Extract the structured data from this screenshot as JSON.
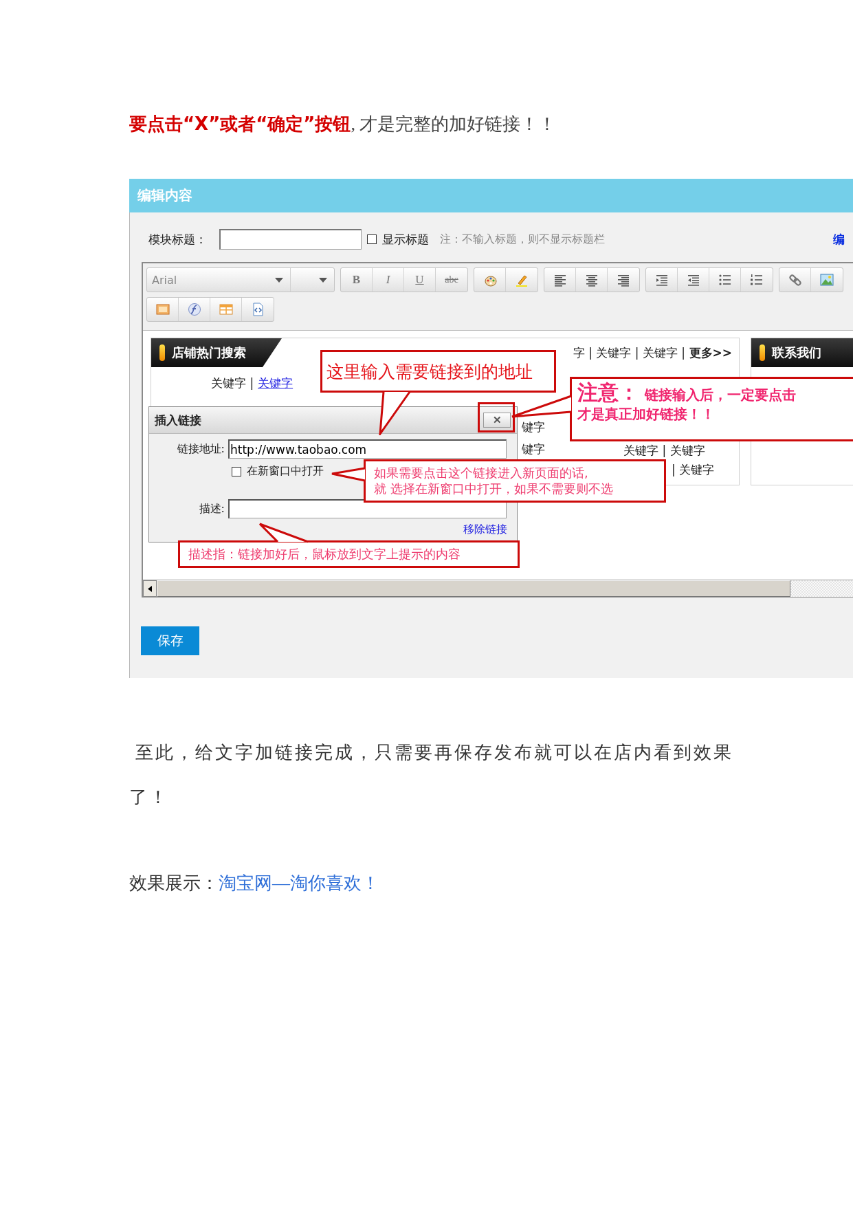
{
  "heading": "**要点击“X”或者“确定”按钮**, 才是完整的加好链接！！",
  "editor": {
    "title": "编辑内容",
    "module_title": {
      "label": "模块标题："
    },
    "show_title": {
      "label": "显示标题",
      "checked": false
    },
    "note": "注：不输入标题，则不显示标题栏",
    "edit_link": "编",
    "toolbar": [
      [
        [
          {
            "kind": "font-select",
            "value": "Arial"
          },
          {
            "kind": "size-select"
          }
        ],
        [
          {
            "kind": "bold",
            "label": "B"
          },
          {
            "kind": "italic",
            "label": "I"
          },
          {
            "kind": "underline",
            "label": "U"
          },
          {
            "kind": "strike",
            "label": "abc"
          }
        ],
        [
          {
            "kind": "text-color"
          },
          {
            "kind": "highlight"
          }
        ],
        [
          {
            "kind": "align-left"
          },
          {
            "kind": "align-center"
          },
          {
            "kind": "align-right"
          }
        ],
        [
          {
            "kind": "indent"
          },
          {
            "kind": "outdent"
          },
          {
            "kind": "bullet-list"
          },
          {
            "kind": "numbered-list"
          }
        ],
        [
          {
            "kind": "link"
          },
          {
            "kind": "image"
          }
        ]
      ],
      [
        [
          {
            "kind": "picture-frame"
          },
          {
            "kind": "flash"
          },
          {
            "kind": "table"
          },
          {
            "kind": "code-file"
          }
        ]
      ]
    ],
    "content": {
      "hot_search": {
        "title": "店铺热门搜索",
        "top_links": "字 | 关键字 | 关键字 | **更多>>**",
        "row_text": "关键字 |",
        "row_link": "关键字",
        "fragments": [
          "键字",
          "键字",
          "关键字 | 关键字",
          "| 关键字"
        ]
      },
      "contact": {
        "title": "联系我们"
      },
      "dialog": {
        "title": "插入链接",
        "close": "✕",
        "url_label": "链接地址:",
        "url_value": "http://www.taobao.com",
        "new_window": {
          "label": "在新窗口中打开",
          "checked": false
        },
        "desc_label": "描述:",
        "remove_link": "移除链接"
      },
      "callouts": [
        {
          "kind": "label",
          "text": "这里输入需要链接到的地址"
        },
        {
          "kind": "warning",
          "title": "注意：",
          "lines": [
            "链接输入后，一定要点击",
            "才是真正加好链接！！"
          ]
        },
        {
          "kind": "note",
          "lines": [
            "如果需要点击这个链接进入新页面的话,",
            "就 选择在新窗口中打开，如果不需要则不选"
          ]
        },
        {
          "kind": "note",
          "lines": [
            "描述指：链接加好后，鼠标放到文字上提示的内容"
          ]
        }
      ]
    },
    "save_button": "保存"
  },
  "summary": "至此，给文字加链接完成，只需要再保存发布就可以在店内看到效果了！",
  "demo": {
    "label": "效果展示：",
    "link": "淘宝网—淘你喜欢！"
  }
}
